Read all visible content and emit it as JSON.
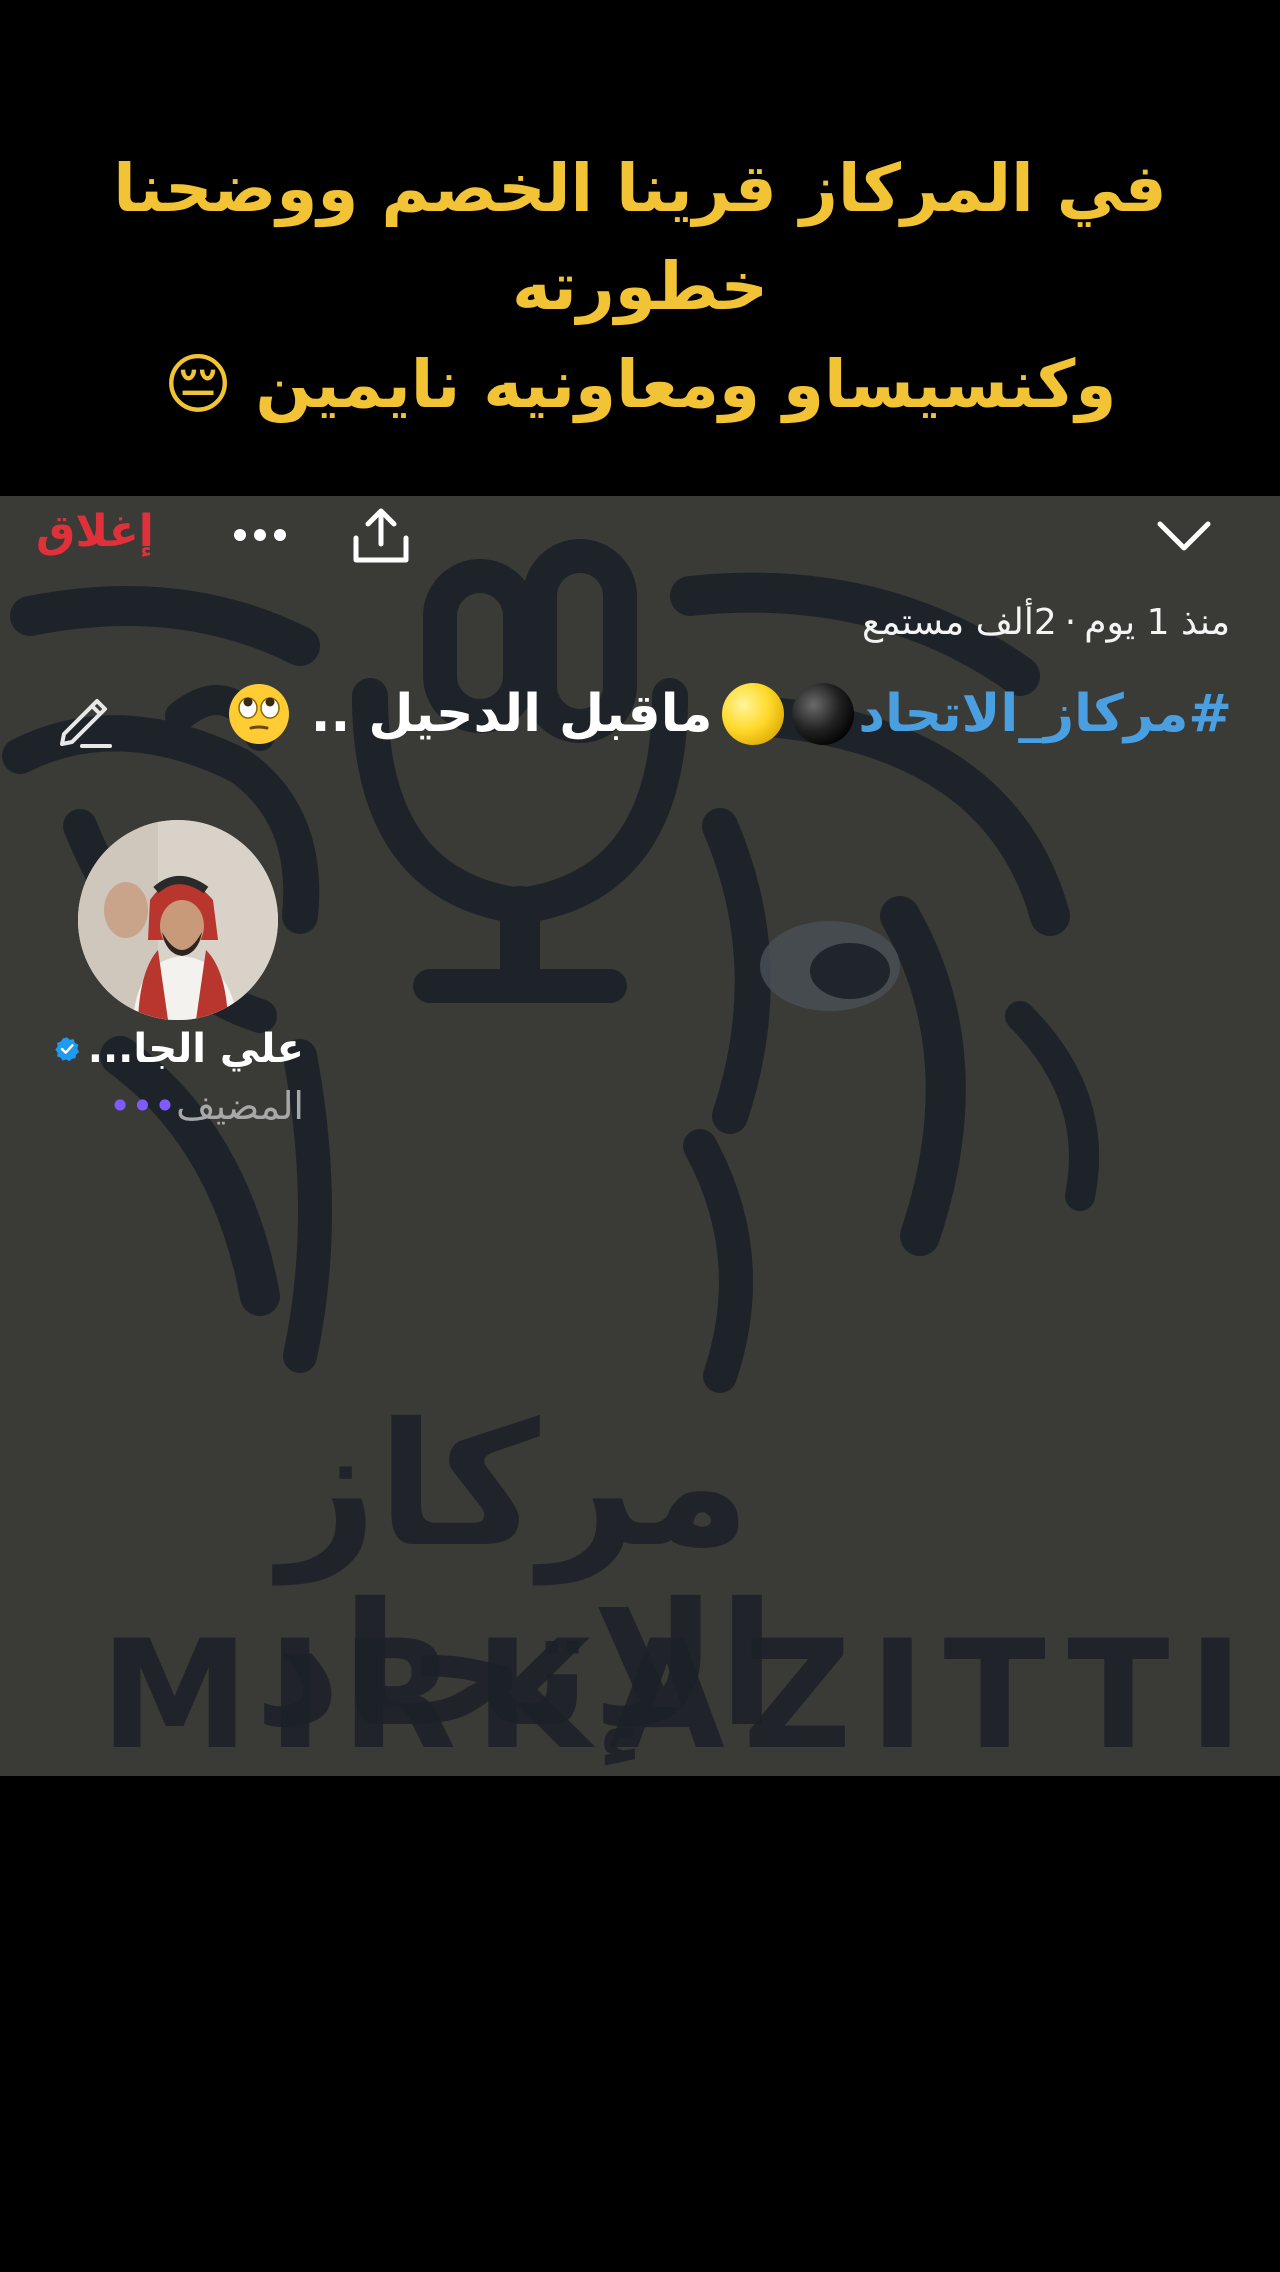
{
  "caption": {
    "line1": "في المركاز قرينا الخصم ووضحنا",
    "line2": "خطورته",
    "line3": "وكنسيساو ومعاونيه نايمين 😔"
  },
  "toolbar": {
    "close_label": "إغلاق"
  },
  "space": {
    "listeners": "2ألف مستمع",
    "separator": "·",
    "time_ago": "منذ 1 يوم",
    "hashtag": "#مركاز_الاتحاد",
    "title_text": "ماقبل الدحيل ..",
    "emojis": [
      "black-circle-emoji",
      "yellow-circle-emoji",
      "eye-roll-emoji"
    ]
  },
  "host": {
    "name": "علي الجا...",
    "role": "المضيف",
    "role_dots": "•••",
    "verified": true
  },
  "logo": {
    "arabic": "مركاز الإتحاد",
    "english": "MIRKAZITTI"
  },
  "colors": {
    "caption": "#f2c335",
    "close": "#e0303a",
    "hashtag": "#4a9fe0",
    "card_bg": "#3a3a36",
    "logo": "#1c2128",
    "verified": "#1d9bf0"
  }
}
